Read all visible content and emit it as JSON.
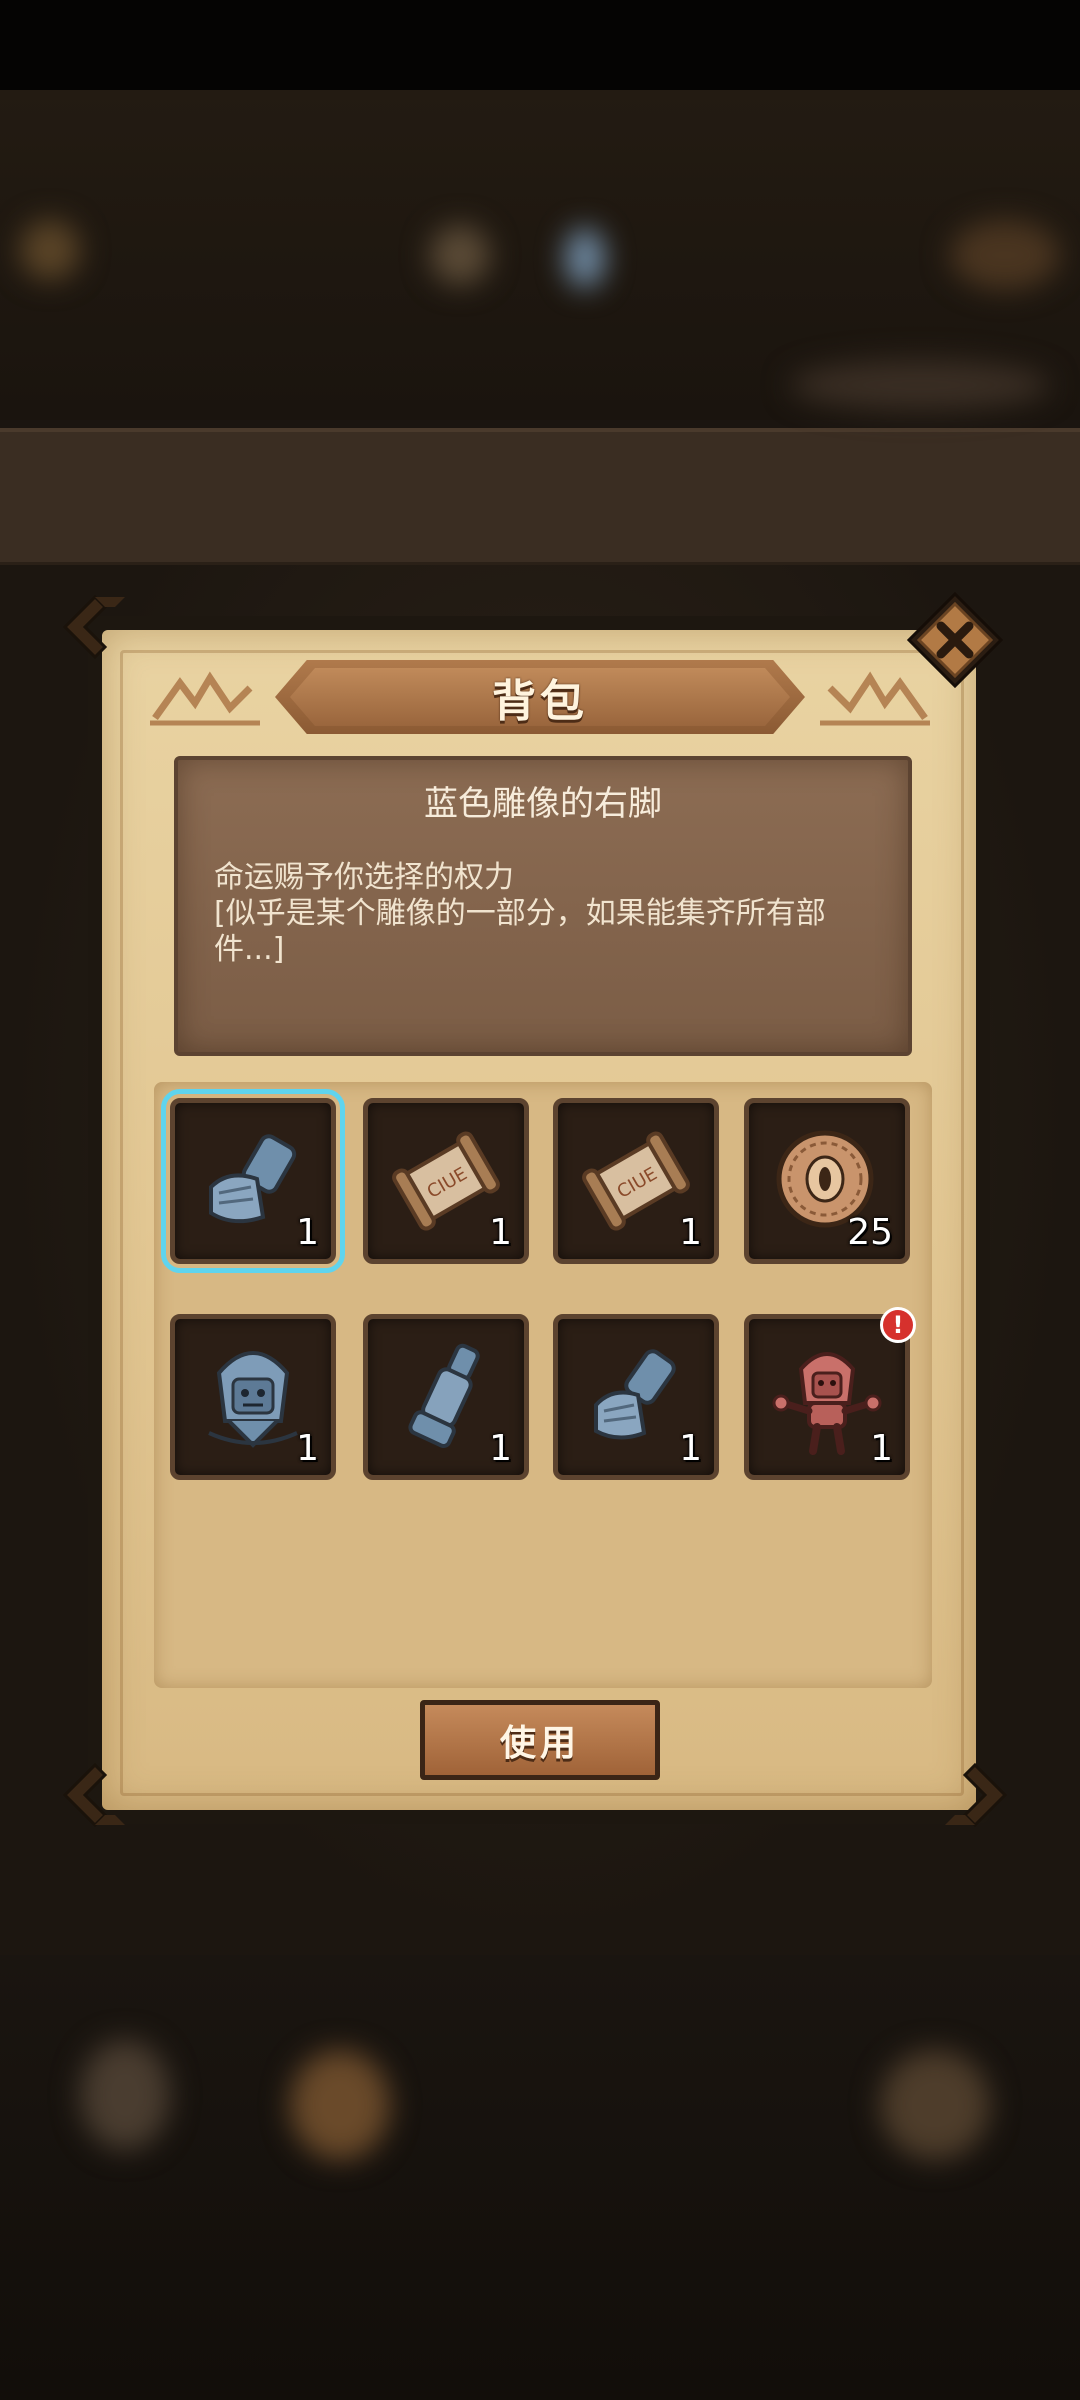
{
  "dialog": {
    "title": "背包",
    "close_icon": "close-x-icon"
  },
  "selected_item": {
    "name": "蓝色雕像的右脚",
    "description": "命运赐予你选择的权力\n[似乎是某个雕像的一部分，如果能集齐所有部件...]"
  },
  "inventory": [
    {
      "icon": "blue-statue-right-foot-icon",
      "count": "1",
      "selected": true
    },
    {
      "icon": "clue-scroll-icon",
      "count": "1"
    },
    {
      "icon": "clue-scroll-icon",
      "count": "1"
    },
    {
      "icon": "eye-coin-icon",
      "count": "25"
    },
    {
      "icon": "blue-statue-head-icon",
      "count": "1"
    },
    {
      "icon": "blue-statue-leg-icon",
      "count": "1"
    },
    {
      "icon": "blue-statue-foot-icon",
      "count": "1"
    },
    {
      "icon": "red-statue-figure-icon",
      "count": "1",
      "alert": "!"
    }
  ],
  "use_button": {
    "label": "使用"
  },
  "colors": {
    "panel": "#e2c793",
    "desc_box": "#7b5d46",
    "slot": "#2b1e15",
    "selected_outline": "#5fd4ee",
    "alert": "#d6312d"
  }
}
